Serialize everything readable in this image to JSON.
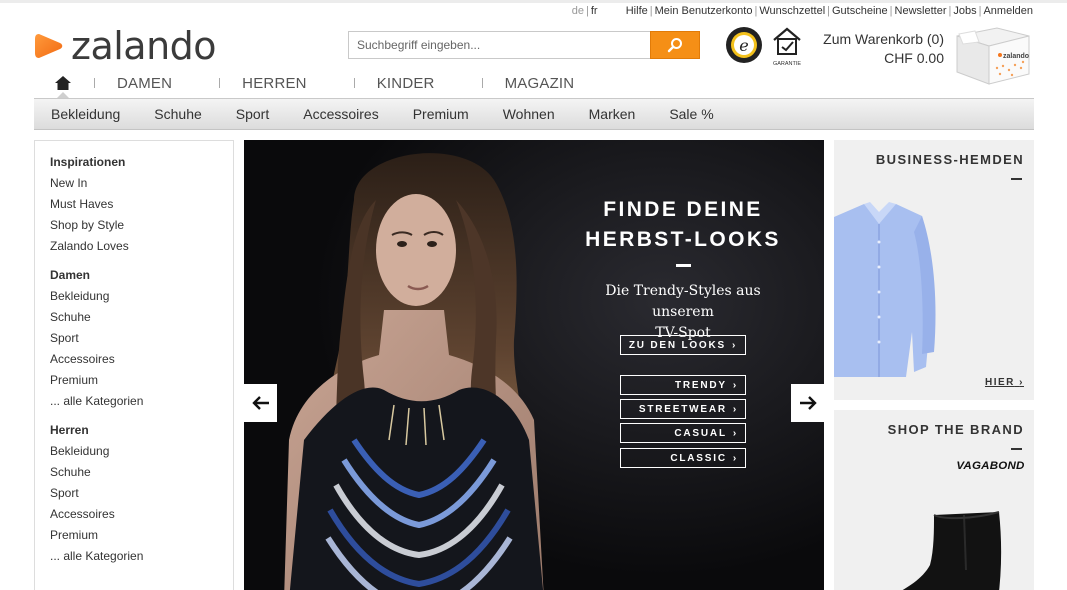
{
  "utility": {
    "lang_de": "de",
    "lang_fr": "fr",
    "links": [
      "Hilfe",
      "Mein Benutzerkonto",
      "Wunschzettel",
      "Gutscheine",
      "Newsletter",
      "Jobs",
      "Anmelden"
    ]
  },
  "logo": {
    "text": "zalando",
    "brand_color": "#f5751b"
  },
  "search": {
    "placeholder": "Suchbegriff eingeben...",
    "button_color": "#f58f16"
  },
  "badges": {
    "garantie_label": "GARANTIE"
  },
  "cart": {
    "label": "Zum Warenkorb (0)",
    "total": "CHF 0.00"
  },
  "gender_nav": [
    "DAMEN",
    "HERREN",
    "KINDER",
    "MAGAZIN"
  ],
  "category_bar": [
    "Bekleidung",
    "Schuhe",
    "Sport",
    "Accessoires",
    "Premium",
    "Wohnen",
    "Marken",
    "Sale %"
  ],
  "sidebar": {
    "groups": [
      {
        "title": "Inspirationen",
        "links": [
          "New In",
          "Must Haves",
          "Shop by Style",
          "Zalando Loves"
        ]
      },
      {
        "title": "Damen",
        "links": [
          "Bekleidung",
          "Schuhe",
          "Sport",
          "Accessoires",
          "Premium",
          "... alle Kategorien"
        ]
      },
      {
        "title": "Herren",
        "links": [
          "Bekleidung",
          "Schuhe",
          "Sport",
          "Accessoires",
          "Premium",
          "... alle Kategorien"
        ]
      }
    ]
  },
  "hero": {
    "title_line1": "FINDE DEINE",
    "title_line2": "HERBST-LOOKS",
    "subtitle_line1": "Die Trendy-Styles aus unserem",
    "subtitle_line2": "TV-Spot",
    "main_button": "ZU DEN LOOKS",
    "style_buttons": [
      "TRENDY",
      "STREETWEAR",
      "CASUAL",
      "CLASSIC"
    ],
    "chevron": "›"
  },
  "promos": {
    "shirts": {
      "title": "BUSINESS-HEMDEN",
      "link": "HIER"
    },
    "brand": {
      "title": "SHOP THE BRAND",
      "brand_name": "VAGABOND"
    }
  }
}
